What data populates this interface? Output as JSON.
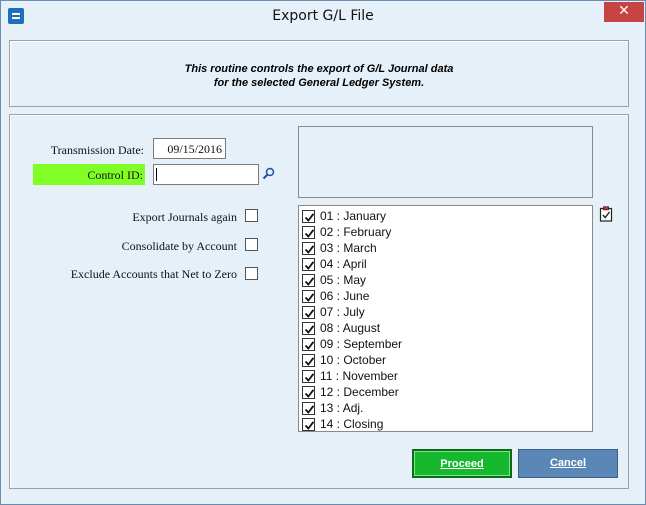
{
  "window": {
    "title": "Export G/L File",
    "close_glyph": "✕"
  },
  "description": {
    "line1": "This routine controls the export of G/L Journal data",
    "line2": "for the selected General Ledger System."
  },
  "form": {
    "transmission_date_label": "Transmission Date:",
    "transmission_date_value": "09/15/2016",
    "control_id_label": "Control ID:",
    "control_id_value": "",
    "export_journals_label": "Export Journals again",
    "consolidate_label": "Consolidate by Account",
    "exclude_label": "Exclude Accounts that Net to Zero"
  },
  "months": [
    {
      "label": "01 : January",
      "checked": true
    },
    {
      "label": "02 : February",
      "checked": true
    },
    {
      "label": "03 : March",
      "checked": true
    },
    {
      "label": "04 : April",
      "checked": true
    },
    {
      "label": "05 : May",
      "checked": true
    },
    {
      "label": "06 : June",
      "checked": true
    },
    {
      "label": "07 : July",
      "checked": true
    },
    {
      "label": "08 : August",
      "checked": true
    },
    {
      "label": "09 : September",
      "checked": true
    },
    {
      "label": "10 : October",
      "checked": true
    },
    {
      "label": "11 : November",
      "checked": true
    },
    {
      "label": "12 : December",
      "checked": true
    },
    {
      "label": "13 : Adj.",
      "checked": true
    },
    {
      "label": "14 : Closing",
      "checked": true
    }
  ],
  "buttons": {
    "proceed": "Proceed",
    "cancel": "Cancel"
  },
  "colors": {
    "control_id_highlight": "#80ff26",
    "proceed": "#16b82e",
    "cancel": "#5a87b5"
  }
}
